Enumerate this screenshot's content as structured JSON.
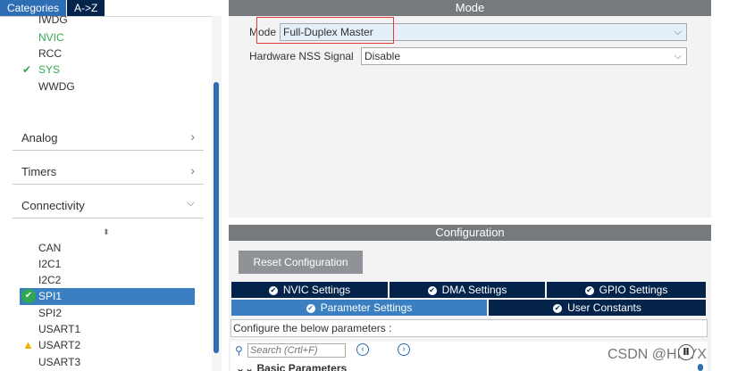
{
  "left_panel": {
    "tabs": [
      {
        "label": "Categories",
        "active": true
      },
      {
        "label": "A->Z",
        "active": false
      }
    ],
    "system_core_items": [
      {
        "label": "IWDG",
        "state": "partial"
      },
      {
        "label": "NVIC",
        "state": "green"
      },
      {
        "label": "RCC",
        "state": "normal"
      },
      {
        "label": "SYS",
        "state": "checked"
      },
      {
        "label": "WWDG",
        "state": "normal"
      }
    ],
    "categories": [
      {
        "label": "Analog",
        "chevron": ">",
        "expanded": false
      },
      {
        "label": "Timers",
        "chevron": ">",
        "expanded": false
      },
      {
        "label": "Connectivity",
        "chevron": "v",
        "expanded": true
      }
    ],
    "sort_icon": "sort-icon",
    "connectivity_items": [
      {
        "label": "CAN",
        "state": "normal"
      },
      {
        "label": "I2C1",
        "state": "normal"
      },
      {
        "label": "I2C2",
        "state": "normal"
      },
      {
        "label": "SPI1",
        "state": "selected-ok"
      },
      {
        "label": "SPI2",
        "state": "normal"
      },
      {
        "label": "USART1",
        "state": "normal"
      },
      {
        "label": "USART2",
        "state": "warning"
      },
      {
        "label": "USART3",
        "state": "normal"
      }
    ]
  },
  "mode_section": {
    "header": "Mode",
    "mode_label": "Mode",
    "mode_value": "Full-Duplex Master",
    "nss_label": "Hardware NSS Signal",
    "nss_value": "Disable"
  },
  "config_section": {
    "header": "Configuration",
    "reset_button": "Reset Configuration",
    "tabs_row1": [
      {
        "label": "NVIC Settings",
        "active": false
      },
      {
        "label": "DMA Settings",
        "active": false
      },
      {
        "label": "GPIO Settings",
        "active": false
      }
    ],
    "tabs_row2": [
      {
        "label": "Parameter Settings",
        "active": true
      },
      {
        "label": "User Constants",
        "active": false
      }
    ],
    "info_text": "Configure the below parameters :",
    "search_placeholder": "Search (Crtl+F)",
    "group_label": "Basic Parameters"
  },
  "watermark": "CSDN @HILYX",
  "colors": {
    "dark_navy": "#03234b",
    "accent_blue": "#2e6eb4",
    "selection_blue": "#3a7fc1",
    "header_gray": "#777a7d",
    "green": "#2fa84f",
    "warning": "#f0b400",
    "red_highlight": "#e43a3a"
  }
}
